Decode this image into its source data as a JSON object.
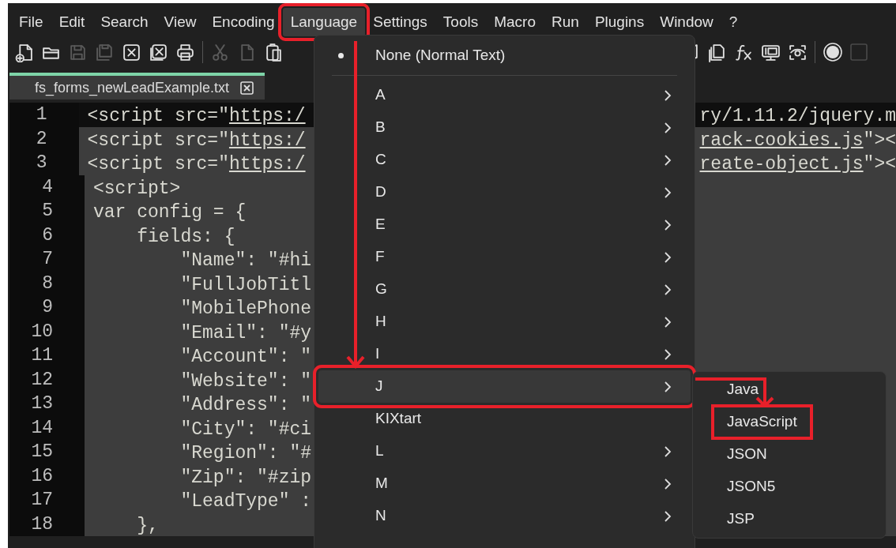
{
  "menu_bar": [
    {
      "label": "File",
      "selected": false
    },
    {
      "label": "Edit",
      "selected": false
    },
    {
      "label": "Search",
      "selected": false
    },
    {
      "label": "View",
      "selected": false
    },
    {
      "label": "Encoding",
      "selected": false
    },
    {
      "label": "Language",
      "selected": true,
      "highlighted": true
    },
    {
      "label": "Settings",
      "selected": false
    },
    {
      "label": "Tools",
      "selected": false
    },
    {
      "label": "Macro",
      "selected": false
    },
    {
      "label": "Run",
      "selected": false
    },
    {
      "label": "Plugins",
      "selected": false
    },
    {
      "label": "Window",
      "selected": false
    },
    {
      "label": "?",
      "selected": false
    }
  ],
  "tab": {
    "label": "fs_forms_newLeadExample.txt"
  },
  "editor": {
    "lines": [
      {
        "number": "1",
        "current": true,
        "left": [
          {
            "text": "<script src=\""
          },
          {
            "text": "https:/",
            "link": true
          }
        ],
        "right": [
          {
            "text": "ry/1.11.2/jquery.m",
            "link": false
          }
        ]
      },
      {
        "number": "2",
        "current": false,
        "left": [
          {
            "text": "<script src=\""
          },
          {
            "text": "https:/",
            "link": true
          }
        ],
        "right": [
          {
            "text": "rack-cookies.js",
            "link": true
          },
          {
            "text": "\"><"
          }
        ]
      },
      {
        "number": "3",
        "current": false,
        "left": [
          {
            "text": "<script src=\""
          },
          {
            "text": "https:/",
            "link": true
          }
        ],
        "right": [
          {
            "text": "reate-object.js",
            "link": true
          },
          {
            "text": "\"><"
          }
        ]
      },
      {
        "number": "4",
        "current": false,
        "left": [
          {
            "text": "<script>"
          }
        ]
      },
      {
        "number": "5",
        "current": false,
        "left": [
          {
            "text": "var config = {"
          }
        ]
      },
      {
        "number": "6",
        "current": false,
        "left": [
          {
            "text": "    fields: {"
          }
        ]
      },
      {
        "number": "7",
        "current": false,
        "left": [
          {
            "text": "        \"Name\": \"#hi"
          }
        ]
      },
      {
        "number": "8",
        "current": false,
        "left": [
          {
            "text": "        \"FullJobTitl"
          }
        ]
      },
      {
        "number": "9",
        "current": false,
        "left": [
          {
            "text": "        \"MobilePhone"
          }
        ]
      },
      {
        "number": "10",
        "current": false,
        "left": [
          {
            "text": "        \"Email\": \"#y"
          }
        ]
      },
      {
        "number": "11",
        "current": false,
        "left": [
          {
            "text": "        \"Account\": \""
          }
        ]
      },
      {
        "number": "12",
        "current": false,
        "left": [
          {
            "text": "        \"Website\": \""
          }
        ]
      },
      {
        "number": "13",
        "current": false,
        "left": [
          {
            "text": "        \"Address\": \""
          }
        ]
      },
      {
        "number": "14",
        "current": false,
        "left": [
          {
            "text": "        \"City\": \"#ci"
          }
        ]
      },
      {
        "number": "15",
        "current": false,
        "left": [
          {
            "text": "        \"Region\": \"#"
          }
        ]
      },
      {
        "number": "16",
        "current": false,
        "left": [
          {
            "text": "        \"Zip\": \"#zip"
          }
        ]
      },
      {
        "number": "17",
        "current": false,
        "left": [
          {
            "text": "        \"LeadType\" :"
          }
        ]
      },
      {
        "number": "18",
        "current": false,
        "left": [
          {
            "text": "    },"
          }
        ]
      }
    ]
  },
  "language_menu": {
    "items": [
      {
        "kind": "radio",
        "label": "None (Normal Text)",
        "checked": true
      },
      {
        "kind": "separator"
      },
      {
        "kind": "submenu",
        "label": "A",
        "selected": false
      },
      {
        "kind": "submenu",
        "label": "B",
        "selected": false
      },
      {
        "kind": "submenu",
        "label": "C",
        "selected": false
      },
      {
        "kind": "submenu",
        "label": "D",
        "selected": false
      },
      {
        "kind": "submenu",
        "label": "E",
        "selected": false
      },
      {
        "kind": "submenu",
        "label": "F",
        "selected": false
      },
      {
        "kind": "submenu",
        "label": "G",
        "selected": false
      },
      {
        "kind": "submenu",
        "label": "H",
        "selected": false
      },
      {
        "kind": "submenu",
        "label": "I",
        "selected": false
      },
      {
        "kind": "submenu",
        "label": "J",
        "selected": true,
        "highlighted": true
      },
      {
        "kind": "plain",
        "label": "KIXtart",
        "selected": false
      },
      {
        "kind": "submenu",
        "label": "L",
        "selected": false
      },
      {
        "kind": "submenu",
        "label": "M",
        "selected": false
      },
      {
        "kind": "submenu",
        "label": "N",
        "selected": false
      }
    ]
  },
  "j_submenu": {
    "items": [
      {
        "label": "Java",
        "highlighted": false
      },
      {
        "label": "JavaScript",
        "highlighted": true
      },
      {
        "label": "JSON",
        "highlighted": false
      },
      {
        "label": "JSON5",
        "highlighted": false
      },
      {
        "label": "JSP",
        "highlighted": false
      }
    ]
  }
}
